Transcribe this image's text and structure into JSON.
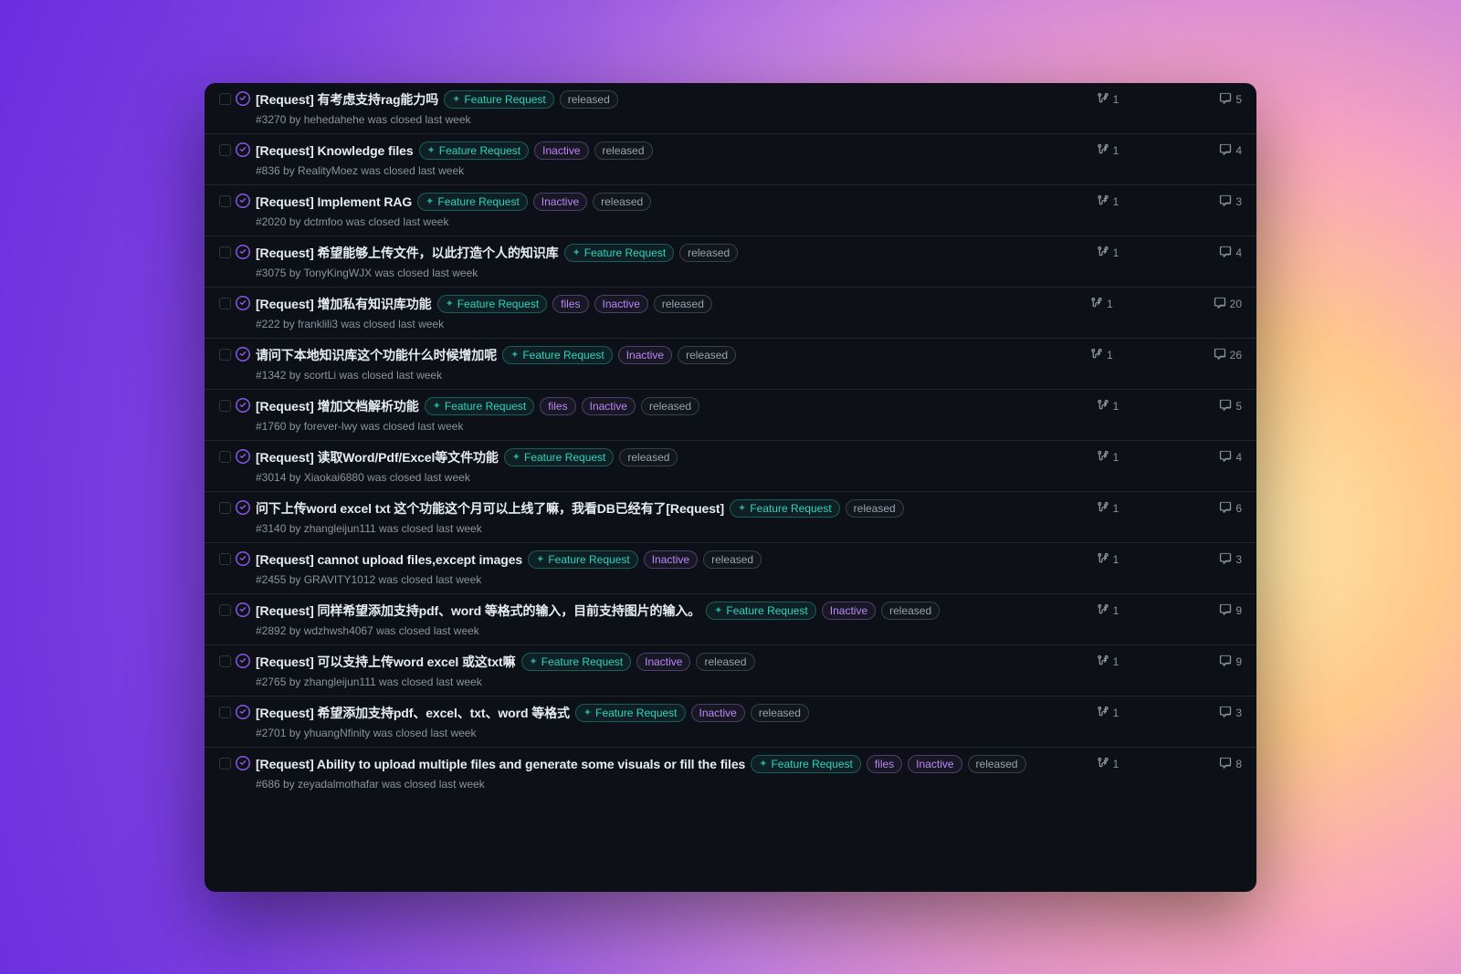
{
  "labels": {
    "feature_request": "Feature Request",
    "inactive": "Inactive",
    "released": "released",
    "files": "files"
  },
  "issues": [
    {
      "title": "[Request] 有考虑支持rag能力吗",
      "meta": "#3270 by hehedahehe was closed last week",
      "tags": [
        "feature",
        "released"
      ],
      "prs": "1",
      "comments": "5"
    },
    {
      "title": "[Request] Knowledge files",
      "meta": "#836 by RealityMoez was closed last week",
      "tags": [
        "feature",
        "inactive",
        "released"
      ],
      "prs": "1",
      "comments": "4"
    },
    {
      "title": "[Request] Implement RAG",
      "meta": "#2020 by dctmfoo was closed last week",
      "tags": [
        "feature",
        "inactive",
        "released"
      ],
      "prs": "1",
      "comments": "3"
    },
    {
      "title": "[Request] 希望能够上传文件，以此打造个人的知识库",
      "meta": "#3075 by TonyKingWJX was closed last week",
      "tags": [
        "feature",
        "released"
      ],
      "prs": "1",
      "comments": "4"
    },
    {
      "title": "[Request] 增加私有知识库功能",
      "meta": "#222 by franklili3 was closed last week",
      "tags": [
        "feature",
        "files",
        "inactive",
        "released"
      ],
      "prs": "1",
      "comments": "20"
    },
    {
      "title": "请问下本地知识库这个功能什么时候增加呢",
      "meta": "#1342 by scortLi was closed last week",
      "tags": [
        "feature",
        "inactive",
        "released"
      ],
      "prs": "1",
      "comments": "26"
    },
    {
      "title": "[Request] 增加文档解析功能",
      "meta": "#1760 by forever-lwy was closed last week",
      "tags": [
        "feature",
        "files",
        "inactive",
        "released"
      ],
      "prs": "1",
      "comments": "5"
    },
    {
      "title": "[Request] 读取Word/Pdf/Excel等文件功能",
      "meta": "#3014 by Xiaokai6880 was closed last week",
      "tags": [
        "feature",
        "released"
      ],
      "prs": "1",
      "comments": "4"
    },
    {
      "title": "问下上传word excel txt 这个功能这个月可以上线了嘛，我看DB已经有了[Request]",
      "meta": "#3140 by zhangleijun111 was closed last week",
      "tags": [
        "feature",
        "released"
      ],
      "prs": "1",
      "comments": "6"
    },
    {
      "title": "[Request] cannot upload files,except images",
      "meta": "#2455 by GRAVITY1012 was closed last week",
      "tags": [
        "feature",
        "inactive",
        "released"
      ],
      "prs": "1",
      "comments": "3"
    },
    {
      "title": "[Request] 同样希望添加支持pdf、word 等格式的输入，目前支持图片的输入。",
      "meta": "#2892 by wdzhwsh4067 was closed last week",
      "tags": [
        "feature",
        "inactive",
        "released"
      ],
      "prs": "1",
      "comments": "9"
    },
    {
      "title": "[Request] 可以支持上传word excel 或这txt嘛",
      "meta": "#2765 by zhangleijun111 was closed last week",
      "tags": [
        "feature",
        "inactive",
        "released"
      ],
      "prs": "1",
      "comments": "9"
    },
    {
      "title": "[Request] 希望添加支持pdf、excel、txt、word 等格式",
      "meta": "#2701 by yhuangNfinity was closed last week",
      "tags": [
        "feature",
        "inactive",
        "released"
      ],
      "prs": "1",
      "comments": "3"
    },
    {
      "title": "[Request] Ability to upload multiple files and generate some visuals or fill the files",
      "meta": "#686 by zeyadalmothafar was closed last week",
      "tags": [
        "feature",
        "files",
        "inactive",
        "released"
      ],
      "prs": "1",
      "comments": "8"
    }
  ]
}
